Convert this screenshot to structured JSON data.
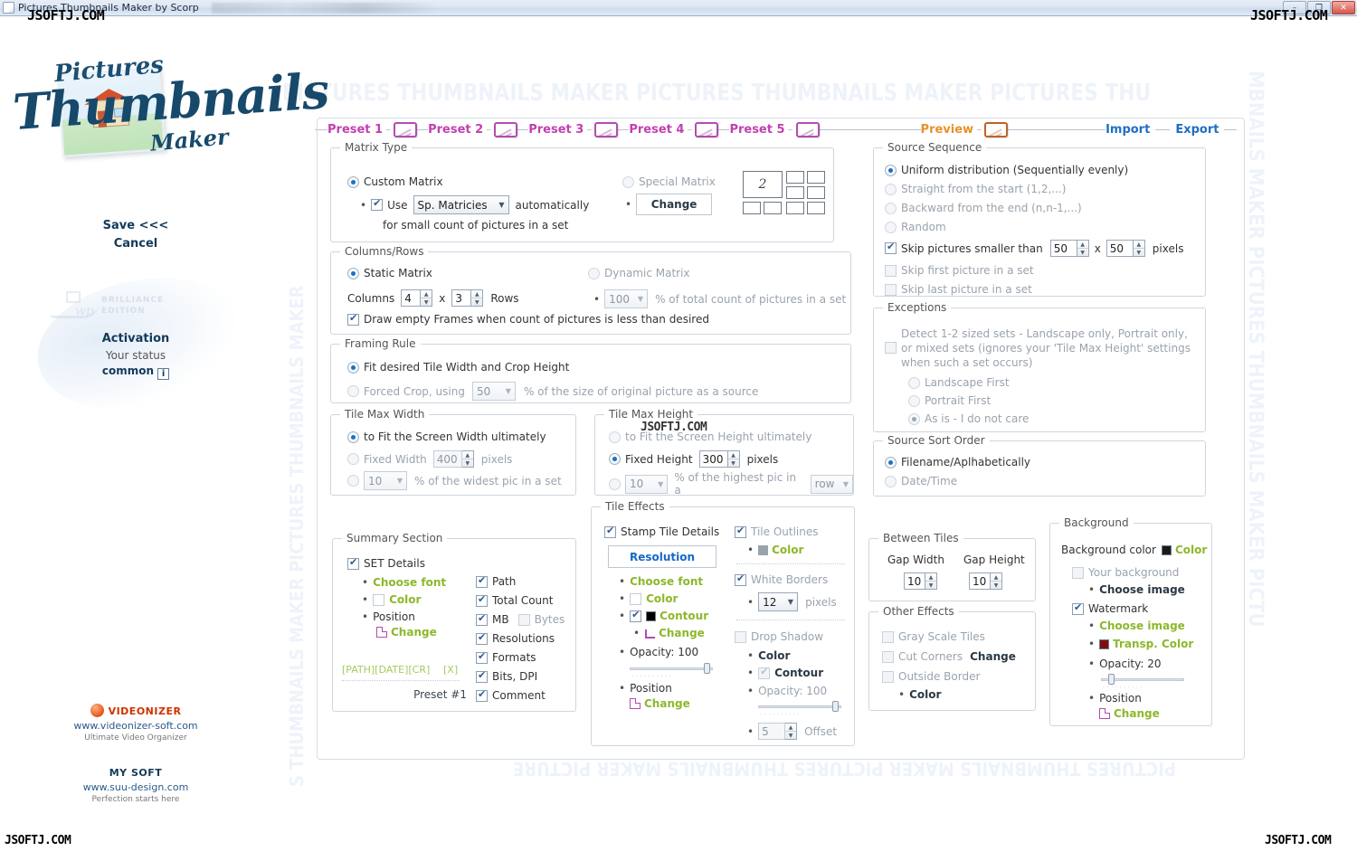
{
  "window": {
    "title": "Pictures Thumbnails Maker by Scorp",
    "buttons": {
      "minimize": "–",
      "maximize": "❐",
      "close": "✕"
    }
  },
  "watermarks": {
    "top": "PICTURES THUMBNAILS MAKER PICTURES THUMBNAILS MAKER PICTURES THU",
    "bottom": "PICTURES THUMBNAILS MAKER PICTURES THUMBNAILS MAKER PICTURE",
    "right": "MBNAILS MAKER PICTURES THUMBNAILS MAKER PICTU",
    "left": "S THUMBNAILS MAKER PICTURES THUMBNAILS MAKER",
    "site": "JSOFTJ.COM"
  },
  "sidebar": {
    "logo": {
      "line1": "Pictures",
      "line2": "Thumbnails",
      "line3": "Maker"
    },
    "save": "Save <<<",
    "cancel": "Cancel",
    "edition": "BRILLIANCE\nEDITION",
    "activation": "Activation",
    "your_status": "Your status",
    "status_value": "common",
    "info_glyph": "i",
    "videonizer": {
      "title": "VIDEONIZER",
      "url": "www.videonizer-soft.com",
      "tagline": "Ultimate Video Organizer"
    },
    "mysoft": {
      "title": "MY SOFT",
      "url": "www.suu-design.com",
      "tagline": "Perfection starts here"
    }
  },
  "presets": {
    "items": [
      {
        "label": "Preset 1"
      },
      {
        "label": "Preset 2"
      },
      {
        "label": "Preset 3"
      },
      {
        "label": "Preset 4"
      },
      {
        "label": "Preset 5"
      }
    ],
    "preview": "Preview",
    "import": "Import",
    "export": "Export"
  },
  "matrix_type": {
    "legend": "Matrix Type",
    "custom_matrix": "Custom Matrix",
    "use": "Use",
    "sp_matricies_value": "Sp. Matricies",
    "automatically": "automatically",
    "small_count_note": "for small count of pictures in a set",
    "special_matrix": "Special Matrix",
    "change": "Change",
    "preview_digit": "2"
  },
  "columns_rows": {
    "legend": "Columns/Rows",
    "static_matrix": "Static Matrix",
    "columns_label": "Columns",
    "columns_value": "4",
    "x": "x",
    "rows_value": "3",
    "rows_label": "Rows",
    "dynamic_matrix": "Dynamic Matrix",
    "percent_value": "100",
    "percent_note": "% of total count of pictures in a set",
    "draw_empty_frames": "Draw empty Frames when count of pictures is less than desired"
  },
  "framing_rule": {
    "legend": "Framing Rule",
    "fit_desired": "Fit desired Tile Width and Crop Height",
    "forced_crop": "Forced Crop, using",
    "forced_crop_value": "50",
    "forced_crop_note": "% of the size of original picture as a source"
  },
  "tile_max_width": {
    "legend": "Tile Max Width",
    "fit_screen": "to Fit the Screen Width ultimately",
    "fixed_label": "Fixed Width",
    "fixed_value": "400",
    "pixels": "pixels",
    "percent_value": "10",
    "percent_note": "% of the widest pic in a set"
  },
  "tile_max_height": {
    "legend": "Tile Max Height",
    "fit_screen": "to Fit the Screen Height ultimately",
    "fixed_label": "Fixed Height",
    "fixed_value": "300",
    "pixels": "pixels",
    "percent_value": "10",
    "percent_note": "% of the highest pic in a",
    "scope_value": "row"
  },
  "source_sequence": {
    "legend": "Source Sequence",
    "uniform": "Uniform distribution (Sequentially evenly)",
    "straight": "Straight from the start (1,2,...)",
    "backward": "Backward from the end (n,n-1,...)",
    "random": "Random",
    "skip_smaller": "Skip pictures smaller than",
    "skip_w": "50",
    "x": "x",
    "skip_h": "50",
    "pixels": "pixels",
    "skip_first": "Skip first picture in a set",
    "skip_last": "Skip last picture in a set"
  },
  "exceptions": {
    "legend": "Exceptions",
    "detect_text": "Detect 1-2 sized sets - Landscape only, Portrait only, or mixed sets (ignores your 'Tile Max Height' settings when such a set occurs)",
    "landscape_first": "Landscape First",
    "portrait_first": "Portrait First",
    "as_is": "As is - I do not care"
  },
  "source_sort_order": {
    "legend": "Source Sort Order",
    "filename": "Filename/Aplhabetically",
    "datetime": "Date/Time"
  },
  "summary_section": {
    "legend": "Summary Section",
    "set_details": "SET Details",
    "choose_font": "Choose font",
    "color": "Color",
    "position": "Position",
    "change": "Change",
    "tokens": "[PATH][DATE][CR]",
    "token_x": "[X]",
    "preset_name": "Preset #1",
    "options": [
      {
        "label": "Path",
        "checked": true
      },
      {
        "label": "Total Count",
        "checked": true
      },
      {
        "label": "MB",
        "checked": true
      },
      {
        "label": "Bytes",
        "checked": false
      },
      {
        "label": "Resolutions",
        "checked": true
      },
      {
        "label": "Formats",
        "checked": true
      },
      {
        "label": "Bits, DPI",
        "checked": true
      },
      {
        "label": "Comment",
        "checked": true
      }
    ]
  },
  "tile_effects": {
    "legend": "Tile Effects",
    "stamp_tile_details": "Stamp Tile Details",
    "resolution": "Resolution",
    "choose_font": "Choose font",
    "color": "Color",
    "contour": "Contour",
    "change": "Change",
    "opacity": "Opacity: 100",
    "position": "Position",
    "position_change": "Change",
    "tile_outlines": "Tile Outlines",
    "outline_color": "Color",
    "white_borders": "White Borders",
    "white_borders_value": "12",
    "pixels": "pixels",
    "drop_shadow": "Drop Shadow",
    "shadow_color": "Color",
    "shadow_contour": "Contour",
    "shadow_opacity": "Opacity: 100",
    "offset_value": "5",
    "offset_label": "Offset"
  },
  "between_tiles": {
    "legend": "Between Tiles",
    "gap_width_label": "Gap Width",
    "gap_width_value": "10",
    "gap_height_label": "Gap Height",
    "gap_height_value": "10"
  },
  "other_effects": {
    "legend": "Other Effects",
    "gray_scale": "Gray Scale Tiles",
    "cut_corners": "Cut Corners",
    "cut_corners_change": "Change",
    "outside_border": "Outside Border",
    "outside_border_color": "Color"
  },
  "background": {
    "legend": "Background",
    "bg_color_label": "Background color",
    "bg_color_link": "Color",
    "your_background": "Your background",
    "choose_image_dark": "Choose image",
    "watermark": "Watermark",
    "choose_image": "Choose image",
    "transp_color": "Transp. Color",
    "opacity": "Opacity: 20",
    "position": "Position",
    "change": "Change"
  },
  "colors": {
    "preset_magenta": "#c23fb0",
    "preview_orange": "#e8912a",
    "link_blue": "#1e6fc4",
    "green": "#8cb82b",
    "watermark_blue": "#eef3fa"
  }
}
